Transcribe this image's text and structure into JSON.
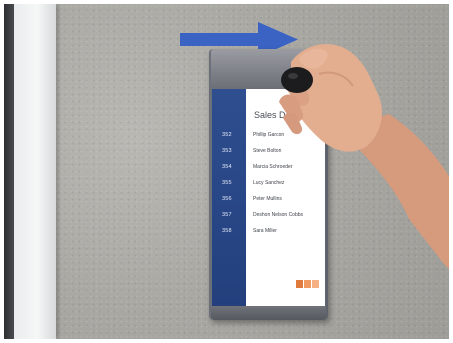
{
  "sign": {
    "title": "Sales Department",
    "entries": [
      {
        "room": "352",
        "name": "Phillip Garcon"
      },
      {
        "room": "353",
        "name": "Steve Bolton"
      },
      {
        "room": "354",
        "name": "Marcia Schroeder"
      },
      {
        "room": "355",
        "name": "Lucy Sanchez"
      },
      {
        "room": "356",
        "name": "Peter Mullins"
      },
      {
        "room": "357",
        "name": "Deshon Nelson Cobbs"
      },
      {
        "room": "358",
        "name": "Sara Miller"
      }
    ]
  },
  "colors": {
    "arrow": "#3a63c4",
    "sign_strip": "#2e4e8f",
    "logo_1": "#e07a3d",
    "logo_2": "#f09a62",
    "logo_3": "#f5b183"
  },
  "icons": {
    "arrow": "right-arrow-icon",
    "logo": "company-logo-icon"
  }
}
